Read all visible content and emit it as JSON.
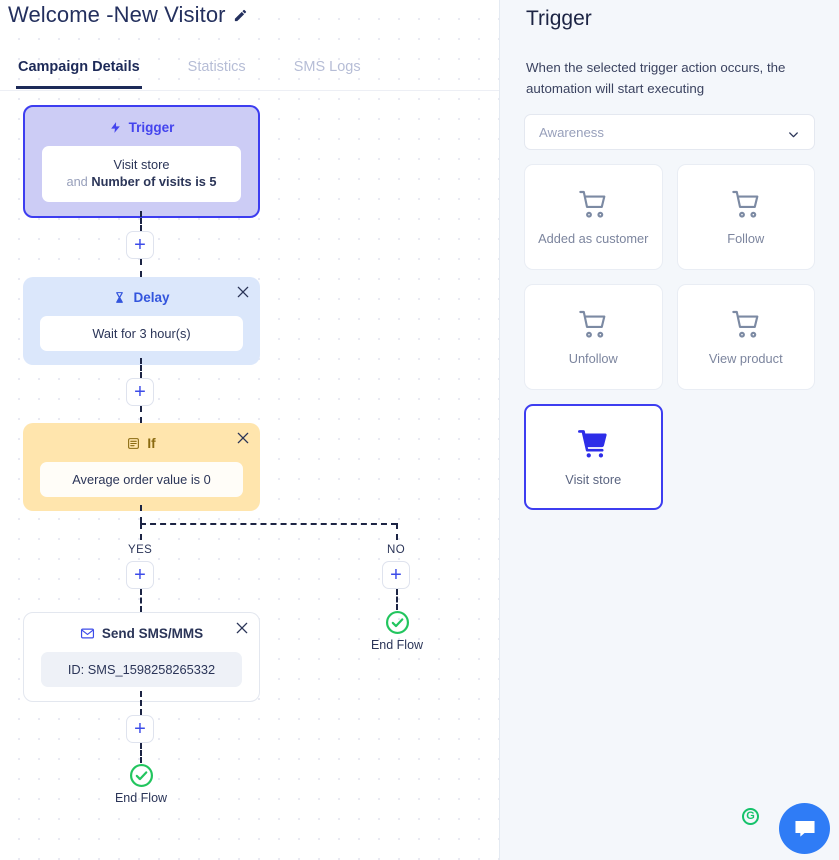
{
  "header": {
    "title": "Welcome -New Visitor",
    "edit_icon": "pencil-icon"
  },
  "tabs": [
    {
      "label": "Campaign Details",
      "active": true
    },
    {
      "label": "Statistics",
      "active": false
    },
    {
      "label": "SMS Logs",
      "active": false
    }
  ],
  "flow": {
    "trigger": {
      "title": "Trigger",
      "icon": "lightning-bolt-icon",
      "condition_line1": "Visit store",
      "condition_and": "and ",
      "condition_line2": "Number of visits is 5"
    },
    "delay": {
      "title": "Delay",
      "icon": "hourglass-icon",
      "body": "Wait for 3 hour(s)",
      "close": "×"
    },
    "if": {
      "title": "If",
      "icon": "list-icon",
      "body": "Average order value is 0",
      "close": "×"
    },
    "branch_yes": "YES",
    "branch_no": "NO",
    "sms": {
      "title": "Send SMS/MMS",
      "icon": "envelope-icon",
      "body": "ID: SMS_1598258265332",
      "close": "×"
    },
    "end_flow_yes": "End Flow",
    "end_flow_no": "End Flow",
    "add_label": "+"
  },
  "panel": {
    "title": "Trigger",
    "description": "When the selected trigger action occurs, the automation will start executing",
    "select": {
      "value": "Awareness",
      "chevron": "chevron-down-icon"
    },
    "cards": [
      {
        "label": "Added as customer",
        "icon": "cart-icon",
        "selected": false
      },
      {
        "label": "Follow",
        "icon": "cart-icon",
        "selected": false
      },
      {
        "label": "Unfollow",
        "icon": "cart-icon",
        "selected": false
      },
      {
        "label": "View product",
        "icon": "cart-icon",
        "selected": false
      },
      {
        "label": "Visit store",
        "icon": "cart-icon",
        "selected": true
      }
    ]
  },
  "widgets": {
    "grammarly": "G",
    "chat": "chat-bubble-icon"
  },
  "colors": {
    "accent": "#3d3df0",
    "trigger_bg": "#ccccf5",
    "delay_bg": "#dbe7fb",
    "if_bg": "#ffe5ad",
    "success": "#22c55e",
    "chat_blue": "#2f7cf6"
  }
}
